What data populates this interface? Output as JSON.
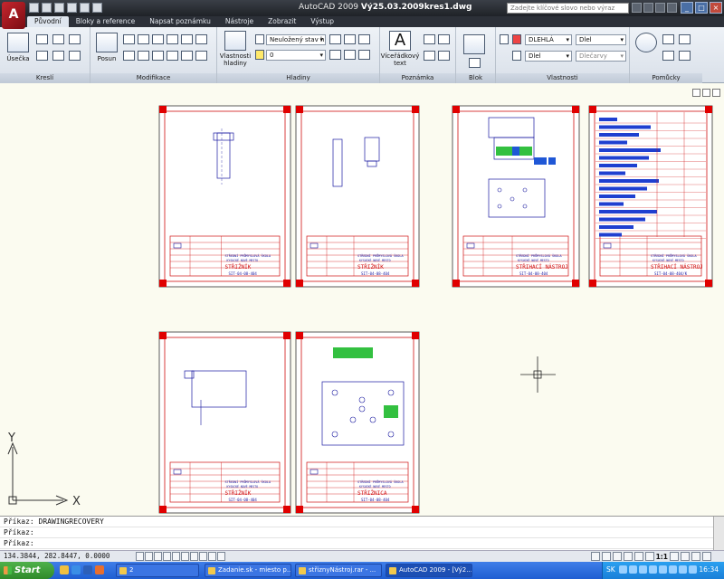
{
  "window": {
    "title_app": "AutoCAD 2009",
    "title_file": "Vý25.03.2009kres1.dwg",
    "search_placeholder": "Zadejte klíčové slovo nebo výraz",
    "logo": "A"
  },
  "ribbon_tabs": [
    "Původní",
    "Bloky a reference",
    "Napsat poznámku",
    "Nástroje",
    "Zobrazit",
    "Výstup"
  ],
  "ribbon": {
    "kresli": {
      "label": "Kreslí",
      "line_tool": "Úsečka"
    },
    "modifikace": {
      "label": "Modifikace",
      "move_tool": "Posun"
    },
    "hladiny": {
      "label": "Hladiny",
      "props_tool": "Vlastnosti hladiny",
      "layer_state": "Neuložený stav h",
      "layer_current": "0"
    },
    "poznamka": {
      "label": "Poznámka",
      "mtext_tool": "Víceřádkový text"
    },
    "blok": {
      "label": "Blok"
    },
    "vlastnosti": {
      "label": "Vlastnosti",
      "color": "DLEHLÁ",
      "linetype": "Dlel",
      "lineweight": "Dlel",
      "plotstyle": "Dlečarvy"
    },
    "pomucky": {
      "label": "Pomůcky"
    }
  },
  "sheets": [
    {
      "name": "STŘIŽNÍK",
      "code": "SIT-04-08-404",
      "school": "STŘEDNÍ PRŮMYSLOVÁ ŠKOLA",
      "city": "KYSUCKÉ NOVÉ MESTO"
    },
    {
      "name": "STŘIŽNÍK",
      "code": "SIT-04-08-404",
      "school": "STŘEDNÍ PRŮMYSLOVÁ ŠKOLA",
      "city": "KYSUCKÉ NOVÉ MESTO"
    },
    {
      "name": "STŘIHACÍ NÁSTROJ",
      "code": "SIT-04-08-404",
      "school": "STŘEDNÍ PRŮMYSLOVÁ ŠKOLA",
      "city": "KYSUCKÉ NOVÉ MESTO"
    },
    {
      "name": "STŘIHACÍ NÁSTROJ",
      "code": "SIT-04-08-404/K",
      "school": "STŘEDNÍ PRŮMYSLOVÁ ŠKOLA",
      "city": "KYSUCKÉ NOVÉ MESTO"
    },
    {
      "name": "STŘIŽNÍK",
      "code": "SIT-04-08-404",
      "school": "STŘEDNÍ PRŮMYSLOVÁ ŠKOLA",
      "city": "KYSUCKÉ NOVÉ MESTO"
    },
    {
      "name": "STŘIŽNICA",
      "code": "SIT-04-08-404",
      "school": "STŘEDNÍ PRŮMYSLOVÁ ŠKOLA",
      "city": "KYSUCKÉ NOVÉ MESTO"
    }
  ],
  "ucs": {
    "x": "X",
    "y": "Y"
  },
  "command_lines": [
    "Příkaz: DRAWINGRECOVERY",
    "Příkaz:",
    "Příkaz:"
  ],
  "status": {
    "coords": "134.3844, 282.8447, 0.0000",
    "scale": "1:1"
  },
  "taskbar": {
    "start": "Start",
    "tasks": [
      "2",
      "Zadanie.sk - miesto p...",
      "střiznyNástroj.rar - ...",
      "AutoCAD 2009 - [Vý2..."
    ],
    "lang": "SK",
    "clock": "16:34"
  }
}
